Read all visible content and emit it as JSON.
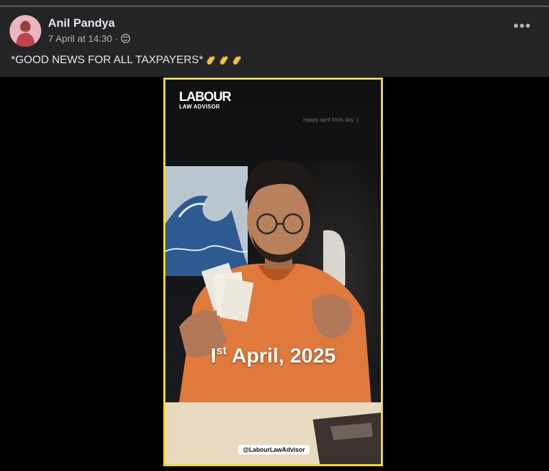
{
  "post": {
    "author": "Anil Pandya",
    "timestamp": "7 April at 14:30",
    "separator": "·",
    "privacy_icon": "globe-icon",
    "more_icon": "more-options-icon",
    "text": "*GOOD NEWS FOR ALL TAXPAYERS*",
    "emojis": [
      "clapping-hands-icon",
      "clapping-hands-icon",
      "clapping-hands-icon"
    ]
  },
  "video": {
    "border_color": "#f2d93a",
    "logo_line1": "LABOUR",
    "logo_line2": "LAW ADVISOR",
    "watermark": "happy april fools day :)",
    "caption_main": "I",
    "caption_sup": "st",
    "caption_rest": " April, 2025",
    "handle": "@LabourLawAdvisor"
  },
  "colors": {
    "background": "#242526",
    "text_primary": "#e4e6eb",
    "text_secondary": "#b0b3b8"
  }
}
